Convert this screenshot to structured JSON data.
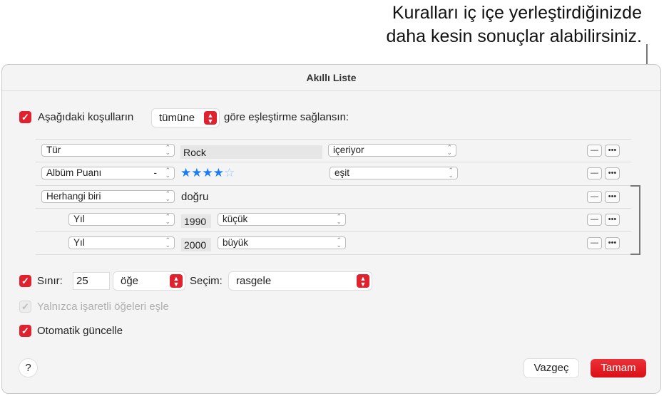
{
  "callout": {
    "line1": "Kuralları iç içe yerleştirdiğinizde",
    "line2": "daha kesin sonuçlar alabilirsiniz."
  },
  "dialog": {
    "title": "Akıllı Liste",
    "match": {
      "checked": true,
      "prefix": "Aşağıdaki koşulların",
      "mode": "tümüne",
      "suffix": "göre eşleştirme sağlansın:"
    },
    "rules": [
      {
        "field": "Tür",
        "value": "Rock",
        "operator": "içeriyor"
      },
      {
        "field": "Albüm Puanı",
        "field_extra": "-",
        "rating": 4,
        "rating_max": 5,
        "rating_filled": "★★★★",
        "rating_empty": "☆",
        "operator": "eşit"
      },
      {
        "field": "Herhangi biri",
        "value": "doğru"
      },
      {
        "field": "Yıl",
        "value": "1990",
        "operator": "küçük"
      },
      {
        "field": "Yıl",
        "value": "2000",
        "operator": "büyük"
      }
    ],
    "remove_label": "—",
    "more_label": "•••",
    "limit": {
      "checked": true,
      "label": "Sınır:",
      "value": "25",
      "unit": "öğe",
      "selection_label": "Seçim:",
      "selection": "rasgele"
    },
    "checked_only": {
      "checked": true,
      "disabled": true,
      "label": "Yalnızca işaretli öğeleri eşle"
    },
    "live_update": {
      "checked": true,
      "label": "Otomatik güncelle"
    },
    "help_label": "?",
    "cancel_label": "Vazgeç",
    "ok_label": "Tamam",
    "checkmark": "✓",
    "accent": "#e0222e",
    "star_color": "#1a7cf5"
  }
}
